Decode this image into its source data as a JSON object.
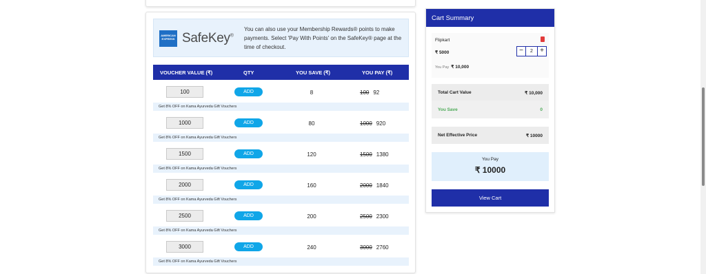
{
  "safekey": {
    "logo_text": "AMERICAN EXPRESS",
    "brand": "SafeKey",
    "brand_mark": "®",
    "info": "You can also use your Membership Rewards® points to make payments. Select 'Pay With Points' on the SafeKey® page at the time of checkout."
  },
  "table": {
    "headers": [
      "VOUCHER VALUE (₹)",
      "QTY",
      "YOU SAVE (₹)",
      "YOU PAY (₹)"
    ],
    "rows": [
      {
        "value": "100",
        "add": "ADD",
        "save": "8",
        "original": "100",
        "pay": "92",
        "note": "Get 8% OFF on Kama Ayurveda Gift Vouchers"
      },
      {
        "value": "1000",
        "add": "ADD",
        "save": "80",
        "original": "1000",
        "pay": "920",
        "note": "Get 8% OFF on Kama Ayurveda Gift Vouchers"
      },
      {
        "value": "1500",
        "add": "ADD",
        "save": "120",
        "original": "1500",
        "pay": "1380",
        "note": "Get 8% OFF on Kama Ayurveda Gift Vouchers"
      },
      {
        "value": "2000",
        "add": "ADD",
        "save": "160",
        "original": "2000",
        "pay": "1840",
        "note": "Get 8% OFF on Kama Ayurveda Gift Vouchers"
      },
      {
        "value": "2500",
        "add": "ADD",
        "save": "200",
        "original": "2500",
        "pay": "2300",
        "note": "Get 8% OFF on Kama Ayurveda Gift Vouchers"
      },
      {
        "value": "3000",
        "add": "ADD",
        "save": "240",
        "original": "3000",
        "pay": "2760",
        "note": "Get 8% OFF on Kama Ayurveda Gift Vouchers"
      }
    ]
  },
  "cart": {
    "title": "Cart Summary",
    "item": {
      "name": "Flipkart",
      "price": "₹ 5000",
      "qty": "2",
      "minus": "−",
      "plus": "+",
      "you_pay_label": "You Pay",
      "you_pay_value": "₹ 10,000"
    },
    "total_label": "Total Cart Value",
    "total_value": "₹ 10,000",
    "save_label": "You Save",
    "save_value": "0",
    "net_label": "Net Effective Price",
    "net_value": "₹ 10000",
    "pay_label": "You Pay",
    "pay_value": "₹ 10000",
    "view_cart": "View Cart"
  },
  "colors": {
    "primary": "#1f2fa8",
    "accent": "#10a6e8",
    "light_blue": "#e8f2fc",
    "save_green": "#4caa57",
    "delete_red": "#e23b3b"
  }
}
